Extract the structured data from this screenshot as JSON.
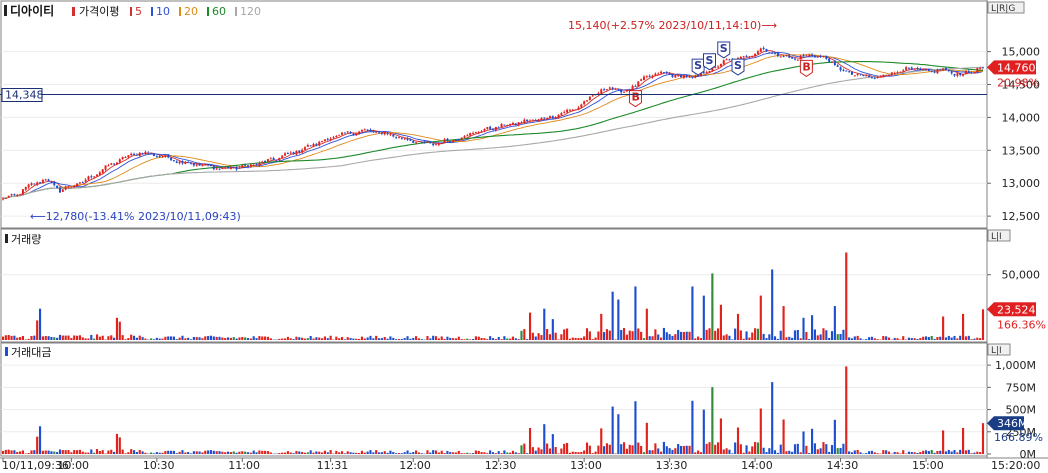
{
  "chart_data": {
    "type": "candlestick",
    "title": "디아이티",
    "legend": {
      "ma_label": "가격이평",
      "ma_periods": [
        {
          "label": "5",
          "color": "#d43030"
        },
        {
          "label": "10",
          "color": "#3050d8"
        },
        {
          "label": "20",
          "color": "#e08a18"
        },
        {
          "label": "60",
          "color": "#1e8a2a"
        },
        {
          "label": "120",
          "color": "#a8a8a8"
        }
      ]
    },
    "x_ticks": [
      {
        "label": "10/11,09:36",
        "t": 0
      },
      {
        "label": "10:00",
        "t": 24
      },
      {
        "label": "10:30",
        "t": 54
      },
      {
        "label": "11:00",
        "t": 84
      },
      {
        "label": "11:31",
        "t": 115
      },
      {
        "label": "12:00",
        "t": 144
      },
      {
        "label": "12:30",
        "t": 174
      },
      {
        "label": "13:00",
        "t": 204
      },
      {
        "label": "13:30",
        "t": 234
      },
      {
        "label": "14:00",
        "t": 264
      },
      {
        "label": "14:30",
        "t": 294
      },
      {
        "label": "15:00",
        "t": 324
      },
      {
        "label": "15:20:00",
        "t": 344
      }
    ],
    "price_panel": {
      "y_ticks": [
        15000,
        14500,
        14000,
        13500,
        13000,
        12500
      ],
      "y_tick_labels": [
        "15,000",
        "14,500",
        "14,000",
        "13,500",
        "13,000",
        "12,500"
      ],
      "ylim": [
        12350,
        15480
      ],
      "scale_tag": "L|R|G",
      "current_price": "14,760",
      "current_value": 14760,
      "current_ratio": "20.98%",
      "reference_line": {
        "label": "14,348",
        "value": 14348
      },
      "high_annotation": "15,140(+2.57% 2023/10/11,14:10)⟶",
      "low_annotation": "⟵12,780(-13.41% 2023/10/11,09:43)",
      "keypoints": [
        [
          0,
          12760
        ],
        [
          5,
          12830
        ],
        [
          10,
          12980
        ],
        [
          15,
          13060
        ],
        [
          20,
          12890
        ],
        [
          28,
          13020
        ],
        [
          35,
          13210
        ],
        [
          42,
          13380
        ],
        [
          48,
          13470
        ],
        [
          55,
          13420
        ],
        [
          62,
          13330
        ],
        [
          70,
          13270
        ],
        [
          78,
          13220
        ],
        [
          86,
          13260
        ],
        [
          95,
          13360
        ],
        [
          104,
          13500
        ],
        [
          112,
          13640
        ],
        [
          118,
          13730
        ],
        [
          126,
          13800
        ],
        [
          134,
          13760
        ],
        [
          142,
          13660
        ],
        [
          150,
          13590
        ],
        [
          158,
          13660
        ],
        [
          166,
          13780
        ],
        [
          174,
          13860
        ],
        [
          182,
          13930
        ],
        [
          190,
          13980
        ],
        [
          196,
          14060
        ],
        [
          202,
          14160
        ],
        [
          208,
          14360
        ],
        [
          213,
          14460
        ],
        [
          218,
          14380
        ],
        [
          224,
          14560
        ],
        [
          230,
          14680
        ],
        [
          236,
          14640
        ],
        [
          242,
          14600
        ],
        [
          248,
          14720
        ],
        [
          254,
          14860
        ],
        [
          260,
          14900
        ],
        [
          266,
          15040
        ],
        [
          272,
          14950
        ],
        [
          278,
          14890
        ],
        [
          284,
          14960
        ],
        [
          290,
          14870
        ],
        [
          294,
          14720
        ],
        [
          300,
          14640
        ],
        [
          306,
          14600
        ],
        [
          312,
          14680
        ],
        [
          318,
          14740
        ],
        [
          324,
          14700
        ],
        [
          330,
          14720
        ],
        [
          336,
          14650
        ],
        [
          340,
          14700
        ],
        [
          344,
          14760
        ]
      ],
      "signals": [
        {
          "t": 222,
          "label": "B",
          "kind": "buy",
          "price": 14300
        },
        {
          "t": 244,
          "label": "S",
          "kind": "sell",
          "price": 14780
        },
        {
          "t": 248,
          "label": "S",
          "kind": "sell",
          "price": 14860
        },
        {
          "t": 253,
          "label": "S",
          "kind": "sell",
          "price": 15040
        },
        {
          "t": 258,
          "label": "S",
          "kind": "sell",
          "price": 14780
        },
        {
          "t": 282,
          "label": "B",
          "kind": "buy",
          "price": 14760
        }
      ],
      "colors": {
        "up": "#e0211c",
        "down": "#1c4ecf",
        "ref_line": "#1a2f74"
      }
    },
    "volume_panel": {
      "title": "거래량",
      "y_ticks": [
        50000
      ],
      "y_tick_labels": [
        "50,000"
      ],
      "ylim": [
        0,
        72000
      ],
      "scale_tag": "L|I",
      "current_value_label": "23,524",
      "current_value": 23524,
      "current_ratio": "166.36%",
      "spikes": [
        {
          "t": 13,
          "v": 24000
        },
        {
          "t": 12,
          "v": 15000
        },
        {
          "t": 40,
          "v": 17000
        },
        {
          "t": 41,
          "v": 14000
        },
        {
          "t": 185,
          "v": 21000
        },
        {
          "t": 190,
          "v": 24000
        },
        {
          "t": 193,
          "v": 16000
        },
        {
          "t": 210,
          "v": 20000
        },
        {
          "t": 214,
          "v": 37000
        },
        {
          "t": 216,
          "v": 31000
        },
        {
          "t": 222,
          "v": 41000
        },
        {
          "t": 226,
          "v": 24000
        },
        {
          "t": 242,
          "v": 41000
        },
        {
          "t": 246,
          "v": 34000
        },
        {
          "t": 249,
          "v": 51000
        },
        {
          "t": 252,
          "v": 27000
        },
        {
          "t": 258,
          "v": 20000
        },
        {
          "t": 266,
          "v": 34000
        },
        {
          "t": 270,
          "v": 54000
        },
        {
          "t": 274,
          "v": 26000
        },
        {
          "t": 281,
          "v": 17000
        },
        {
          "t": 284,
          "v": 19000
        },
        {
          "t": 292,
          "v": 26000
        },
        {
          "t": 296,
          "v": 67000
        },
        {
          "t": 330,
          "v": 18000
        },
        {
          "t": 337,
          "v": 20000
        },
        {
          "t": 344,
          "v": 23524
        }
      ]
    },
    "amount_panel": {
      "title": "거래대금",
      "y_ticks": [
        1000,
        750,
        500,
        250,
        0
      ],
      "y_tick_labels": [
        "1,000M",
        "750M",
        "500M",
        "250M",
        "0M"
      ],
      "ylim": [
        0,
        1080
      ],
      "scale_tag": "L|I",
      "current_value_label": "346M",
      "current_value": 346,
      "current_ratio": "166.89%"
    }
  }
}
